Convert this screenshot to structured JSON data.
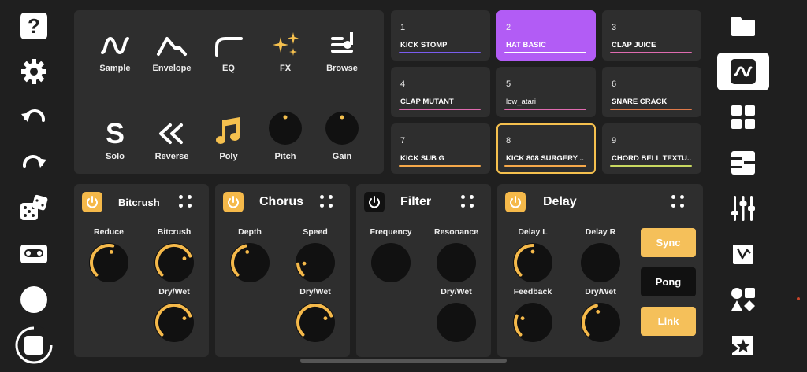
{
  "left_toolbar": {
    "icons": [
      "help-icon",
      "settings-gear-icon",
      "undo-icon",
      "redo-icon",
      "dice-random-icon",
      "cassette-tape-icon",
      "record-circle-icon",
      "stop-button-icon"
    ]
  },
  "tools": [
    {
      "label": "Sample",
      "icon": "sample-wave-icon"
    },
    {
      "label": "Envelope",
      "icon": "envelope-icon"
    },
    {
      "label": "EQ",
      "icon": "eq-curve-icon"
    },
    {
      "label": "FX",
      "icon": "fx-sparkle-icon"
    },
    {
      "label": "Browse",
      "icon": "browse-list-icon"
    },
    {
      "label": "Solo",
      "icon": "solo-s-icon"
    },
    {
      "label": "Reverse",
      "icon": "reverse-chevrons-icon"
    },
    {
      "label": "Poly",
      "icon": "poly-music-note-icon"
    },
    {
      "label": "Pitch",
      "icon": "pitch-knob"
    },
    {
      "label": "Gain",
      "icon": "gain-knob"
    }
  ],
  "pads": [
    {
      "num": "1",
      "name": "KICK STOMP",
      "line": "#7a5cf0"
    },
    {
      "num": "2",
      "name": "HAT BASIC",
      "line": "#ffffff"
    },
    {
      "num": "3",
      "name": "CLAP JUICE",
      "line": "#e06bb0"
    },
    {
      "num": "4",
      "name": "CLAP MUTANT",
      "line": "#e06bb0"
    },
    {
      "num": "5",
      "name": "low_atari",
      "line": "#e06bb0"
    },
    {
      "num": "6",
      "name": "SNARE CRACK",
      "line": "#e07a4a"
    },
    {
      "num": "7",
      "name": "KICK SUB G",
      "line": "#f5a84a"
    },
    {
      "num": "8",
      "name": "KICK 808 SURGERY ..",
      "line": "#f5a84a"
    },
    {
      "num": "9",
      "name": "CHORD BELL TEXTU..",
      "line": "#c8d860"
    }
  ],
  "effects": {
    "bitcrush": {
      "title": "Bitcrush",
      "power": "on",
      "knobs": [
        {
          "label": "Reduce",
          "value": 0.55
        },
        {
          "label": "Bitcrush",
          "value": 0.75
        },
        {
          "label": "Dry/Wet",
          "value": 0.75
        }
      ]
    },
    "chorus": {
      "title": "Chorus",
      "power": "on",
      "knobs": [
        {
          "label": "Depth",
          "value": 0.45
        },
        {
          "label": "Speed",
          "value": 0.15
        },
        {
          "label": "Dry/Wet",
          "value": 0.75
        }
      ]
    },
    "filter": {
      "title": "Filter",
      "power": "off",
      "knobs": [
        {
          "label": "Frequency",
          "value": 0.0
        },
        {
          "label": "Resonance",
          "value": 0.0
        },
        {
          "label": "Dry/Wet",
          "value": 0.0
        }
      ]
    },
    "delay": {
      "title": "Delay",
      "power": "on",
      "knobs": [
        {
          "label": "Delay L",
          "value": 0.5
        },
        {
          "label": "Delay R",
          "value": 0.0
        },
        {
          "label": "Feedback",
          "value": 0.25
        },
        {
          "label": "Dry/Wet",
          "value": 0.45
        }
      ],
      "buttons": [
        {
          "label": "Sync",
          "state": "on"
        },
        {
          "label": "Pong",
          "state": "off"
        },
        {
          "label": "Link",
          "state": "on"
        }
      ]
    }
  },
  "right_toolbar": {
    "icons": [
      "folder-icon",
      "waveform-icon",
      "pads-grid-icon",
      "piano-keys-icon",
      "mixer-sliders-icon",
      "drum-machine-icon",
      "shapes-icon",
      "star-tag-icon"
    ],
    "active": "waveform-icon"
  },
  "colors": {
    "accent": "#f5b94a",
    "pad_selected": "#b25cf5",
    "panel": "#2e2e2e",
    "background": "#1f1f1f"
  }
}
